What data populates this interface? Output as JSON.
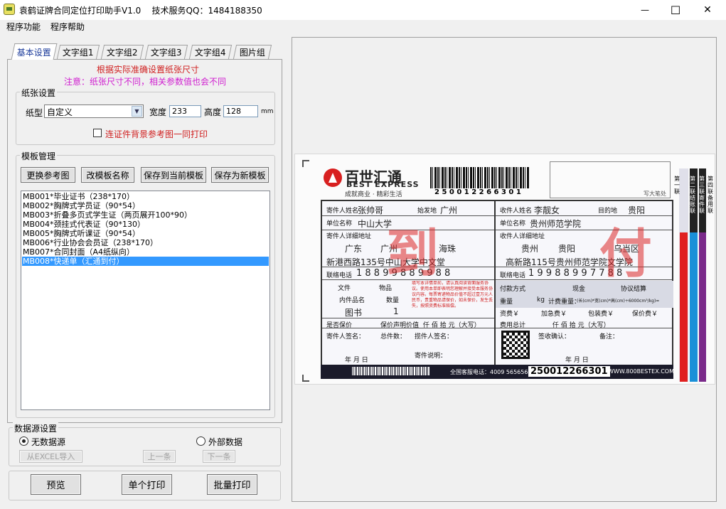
{
  "app": {
    "title": "袁鹤证牌合同定位打印助手V1.0    技术服务QQ：1484188350",
    "minimize": "—",
    "maximize": "☐",
    "close": "✕"
  },
  "menu": [
    "程序功能",
    "程序帮助"
  ],
  "tabs": [
    "基本设置",
    "文字组1",
    "文字组2",
    "文字组3",
    "文字组4",
    "图片组"
  ],
  "notice": {
    "line1": "根据实际准确设置纸张尺寸",
    "line2": "注意：纸张尺寸不同，相关参数值也会不同",
    "line1_color": "#d02020",
    "line2_color": "#d020d0"
  },
  "paper": {
    "group": "纸张设置",
    "type_label": "纸型",
    "type_value": "自定义",
    "width_label": "宽度",
    "width_value": "233",
    "height_label": "高度",
    "height_value": "128",
    "unit": "mm",
    "checkbox_label": "连证件背景参考图一同打印",
    "checkbox_checked": false
  },
  "template": {
    "group": "模板管理",
    "buttons": [
      "更换参考图",
      "改模板名称",
      "保存到当前模板",
      "保存为新模板"
    ],
    "items": [
      "MB001*毕业证书（238*170）",
      "MB002*胸牌式学员证（90*54）",
      "MB003*折叠多页式学生证（两页展开100*90）",
      "MB004*颈挂式代表证（90*130）",
      "MB005*胸牌式听课证（90*54）",
      "MB006*行业协会会员证（238*170）",
      "MB007*合同封面（A4纸纵向）",
      "MB008*快递单（汇通到付）"
    ],
    "selected_index": 7
  },
  "datasource": {
    "group": "数据源设置",
    "radio_none": "无数据源",
    "radio_external": "外部数据",
    "selected": "none",
    "import_btn": "从EXCEL导入",
    "prev_btn": "上一条",
    "next_btn": "下一条"
  },
  "actions": {
    "preview": "预览",
    "single_print": "单个打印",
    "batch_print": "批量打印"
  },
  "bill": {
    "brand_cn": "百世汇通",
    "brand_en": "BEST EXPRESS",
    "slogan": "成就商业 · 精彩生活",
    "barcode": "2 5 0 0 1 2 2 6 6 3 0 1",
    "barcode2": "250012266301",
    "stamp": "到 付",
    "write_note": "写大笔处",
    "sender": {
      "name_label": "寄件人姓名",
      "name": "张帅哥",
      "origin_label": "始发地",
      "origin": "广州",
      "company_label": "单位名称",
      "company": "中山大学",
      "address_label": "寄件人详细地址",
      "province": "广东",
      "city": "广州",
      "district": "海珠",
      "street": "新港西路135号中山大学中文堂",
      "phone_label": "联络电话",
      "phone": "1 8 8 9 9 8 8 9 9 8 8"
    },
    "receiver": {
      "name_label": "收件人姓名",
      "name": "李靓女",
      "dest_label": "目的地",
      "dest": "贵阳",
      "company_label": "单位名称",
      "company": "贵州师范学院",
      "address_label": "收件人详细地址",
      "province": "贵州",
      "city": "贵阳",
      "district": "乌当区",
      "street": "高新路115号贵州师范学院文学院",
      "phone_label": "联络电话",
      "phone": "1 9 9 8 8 9 9 7 7 8 8"
    },
    "goods": {
      "file": "文件",
      "item": "物品",
      "name_label": "内件品名",
      "qty_label": "数量",
      "name": "图书",
      "qty": "1"
    },
    "pay": {
      "method": "付款方式",
      "cash": "现金",
      "contract": "协议结算",
      "weight": "重量",
      "kg": "kg",
      "charge_weight": "计费重量：",
      "formula": "(长(cm)*宽(cm)*高(cm)÷6000cm³/kg)=",
      "fee": "资费￥",
      "express_fee": "加急费￥",
      "pack_fee": "包装费￥",
      "insure_fee": "保价费￥",
      "total": "费用总计",
      "digits": "仟    佰    拾    元（大写）"
    },
    "insure": {
      "label": "是否保价",
      "yes": "是",
      "no": "否",
      "value": "保价声明价值",
      "digits": "仟    佰    拾    元（大写）"
    },
    "sign": {
      "sender_sign": "寄件人签名：",
      "item_name": "总件数：",
      "collector": "揽件人签名：",
      "collector_note": "寄件说明：",
      "receive": "签收确认：",
      "remark": "备注：",
      "date": "年    月    日"
    },
    "footer": {
      "hotline": "全国客服电话：4009 565656",
      "site": "WWW.800BESTEX.COM"
    },
    "side_labels": [
      "第一联",
      "第二联 结账联",
      "第三联 寄件联",
      "第四联 备用联"
    ],
    "warning": "填写本详情单前，请认真阅读背面服务协议。使用本单即表明您理解并接受本服务协议内容。每票寄递物品价值不超过壹万元人民币，贵重物品请保价，如未保价，发生丢失，按照资费标准赔偿。"
  }
}
